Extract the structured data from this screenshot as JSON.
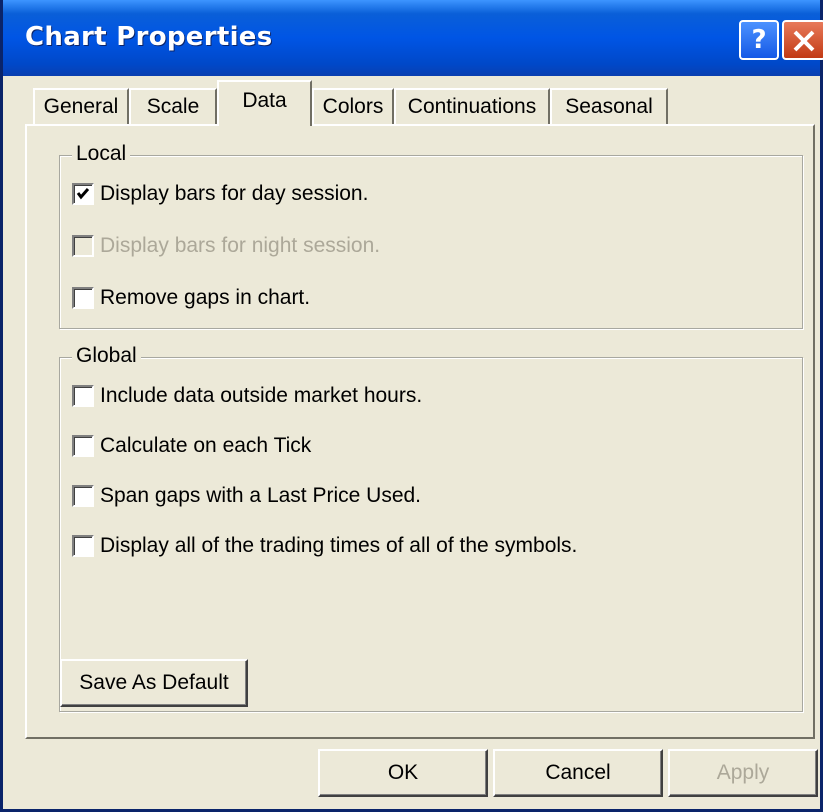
{
  "window": {
    "title": "Chart Properties"
  },
  "titlebar_buttons": {
    "help": "?",
    "close_icon": "close-x-icon"
  },
  "tabs": [
    {
      "label": "General"
    },
    {
      "label": "Scale"
    },
    {
      "label": "Data",
      "active": true
    },
    {
      "label": "Colors"
    },
    {
      "label": "Continuations"
    },
    {
      "label": "Seasonal"
    }
  ],
  "local": {
    "title": "Local",
    "options": [
      {
        "label": "Display bars for day session.",
        "checked": true,
        "enabled": true
      },
      {
        "label": "Display bars for night session.",
        "checked": false,
        "enabled": false
      },
      {
        "label": "Remove gaps in chart.",
        "checked": false,
        "enabled": true
      }
    ]
  },
  "global": {
    "title": "Global",
    "options": [
      {
        "label": "Include data outside market hours.",
        "checked": false
      },
      {
        "label": "Calculate on each Tick",
        "checked": false
      },
      {
        "label": "Span gaps with a Last Price Used.",
        "checked": false
      },
      {
        "label": "Display all of the trading times of all of the symbols.",
        "checked": false
      }
    ]
  },
  "buttons": {
    "save_default": "Save As Default",
    "ok": "OK",
    "cancel": "Cancel",
    "apply": "Apply"
  },
  "colors": {
    "titlebar": "#0055e5",
    "dialog_bg": "#ece9d8",
    "disabled_text": "#aca899"
  }
}
